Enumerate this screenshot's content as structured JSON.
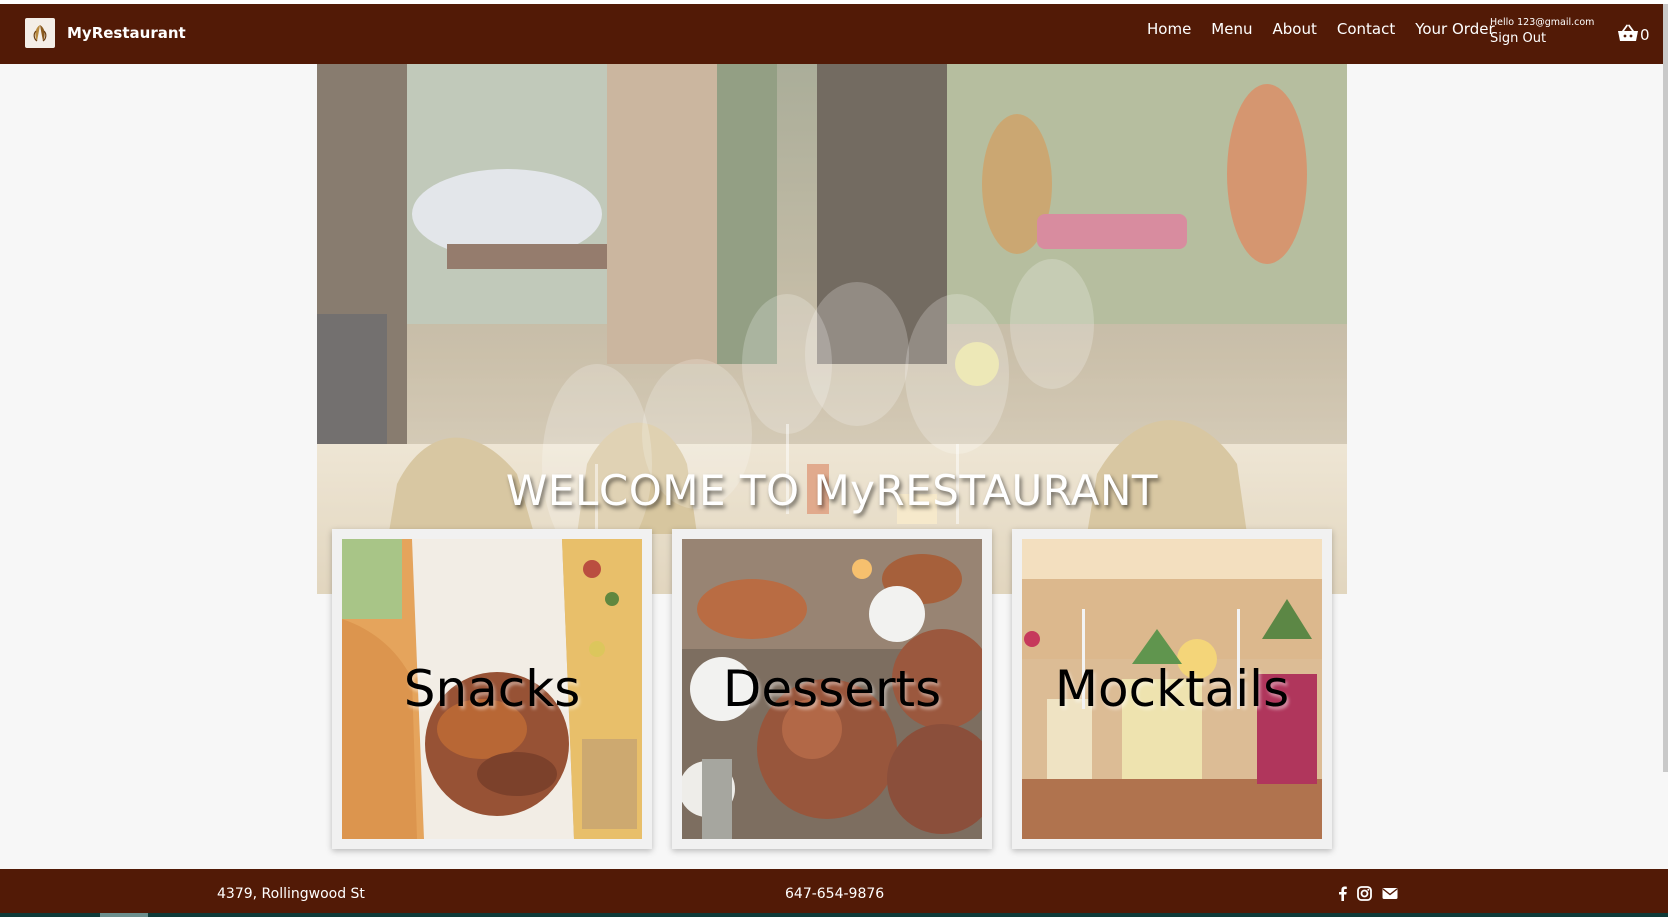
{
  "navbar": {
    "brand": "MyRestaurant",
    "links": [
      "Home",
      "Menu",
      "About",
      "Contact",
      "Your Order"
    ],
    "user_greeting": "Hello 123@gmail.com",
    "sign_out": "Sign Out",
    "cart_count": "0",
    "cart_icon": "basket-icon",
    "logo_icon": "restaurant-logo-icon"
  },
  "hero": {
    "title": "WELCOME TO MyRESTAURANT"
  },
  "categories": [
    {
      "label": "Snacks"
    },
    {
      "label": "Desserts"
    },
    {
      "label": "Mocktails"
    }
  ],
  "footer": {
    "address": "4379, Rollingwood St",
    "phone": "647-654-9876",
    "icons": [
      "facebook-icon",
      "instagram-icon",
      "envelope-icon"
    ]
  },
  "colors": {
    "brand": "#521a06",
    "page_background": "#f7f7f7",
    "footer_bottom": "#0e3a38"
  }
}
